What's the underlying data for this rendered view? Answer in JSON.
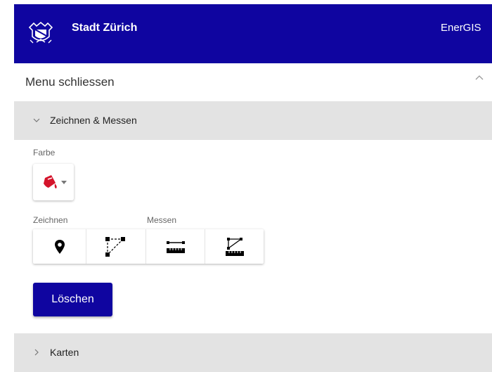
{
  "header": {
    "city_name": "Stadt Zürich",
    "app_name": "EnerGIS"
  },
  "menu": {
    "close_label": "Menu schliessen"
  },
  "sections": {
    "draw_measure": {
      "title": "Zeichnen & Messen",
      "color_label": "Farbe",
      "draw_label": "Zeichnen",
      "measure_label": "Messen",
      "delete_label": "Löschen"
    },
    "maps": {
      "title": "Karten"
    }
  },
  "colors": {
    "header_bg": "#0f05a0",
    "section_bg": "#e3e3e3",
    "selected_draw_color": "#d4142b"
  },
  "icons": [
    "crest-icon",
    "chevron-up-icon",
    "chevron-down-icon",
    "paint-bucket-icon",
    "caret-down-icon",
    "map-marker-icon",
    "draw-polyline-icon",
    "measure-line-icon",
    "measure-polyline-icon",
    "chevron-right-icon"
  ]
}
